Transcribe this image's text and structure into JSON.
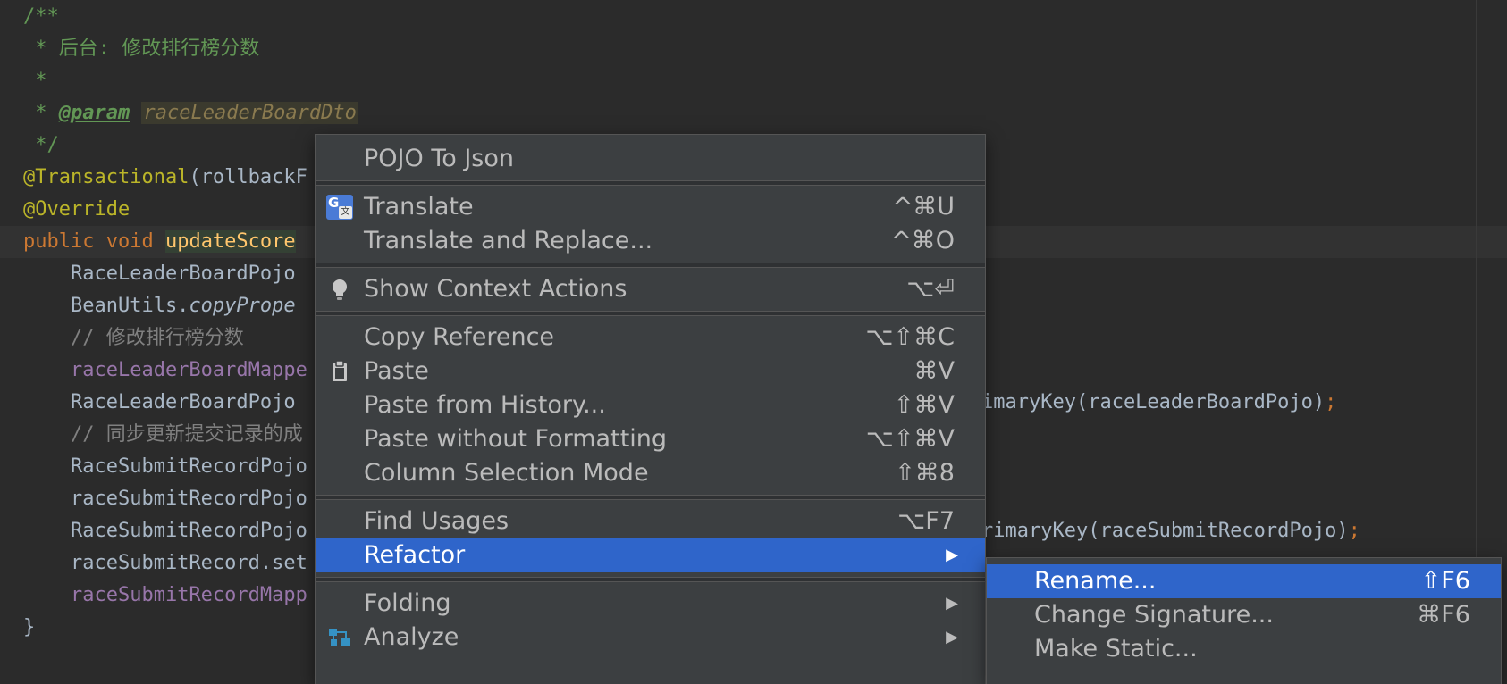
{
  "editor": {
    "lines": [
      [
        {
          "t": "/**",
          "c": "c-doc"
        }
      ],
      [
        {
          "t": " * 后台: 修改排行榜分数",
          "c": "c-doc"
        }
      ],
      [
        {
          "t": " *",
          "c": "c-doc"
        }
      ],
      [
        {
          "t": " * ",
          "c": "c-doc"
        },
        {
          "t": "@param",
          "c": "c-doctag"
        },
        {
          "t": " ",
          "c": "c-doc"
        },
        {
          "t": "raceLeaderBoardDto",
          "c": "c-docparam"
        }
      ],
      [
        {
          "t": " */",
          "c": "c-doc"
        }
      ],
      [
        {
          "t": "@Transactional",
          "c": "c-ann"
        },
        {
          "t": "(rollbackF",
          "c": ""
        }
      ],
      [
        {
          "t": "@Override",
          "c": "c-ann"
        }
      ],
      [
        {
          "t": "public ",
          "c": "c-kw"
        },
        {
          "t": "void ",
          "c": "c-kw"
        },
        {
          "t": "updateScore",
          "c": "c-fn"
        }
      ],
      [
        {
          "t": "    RaceLeaderBoardPojo",
          "c": ""
        }
      ],
      [
        {
          "t": "    BeanUtils.",
          "c": ""
        },
        {
          "t": "copyPrope",
          "c": "c-italic"
        }
      ],
      [
        {
          "t": "    // 修改排行榜分数",
          "c": "c-comment"
        }
      ],
      [
        {
          "t": "    ",
          "c": ""
        },
        {
          "t": "raceLeaderBoardMappe",
          "c": "c-field"
        }
      ],
      [
        {
          "t": "    RaceLeaderBoardPojo",
          "c": ""
        }
      ],
      [
        {
          "t": "    // 同步更新提交记录的成",
          "c": "c-comment"
        }
      ],
      [
        {
          "t": "    RaceSubmitRecordPojo",
          "c": ""
        }
      ],
      [
        {
          "t": "    raceSubmitRecordPojo",
          "c": ""
        }
      ],
      [
        {
          "t": "    RaceSubmitRecordPojo",
          "c": ""
        }
      ],
      [
        {
          "t": "    raceSubmitRecord.set",
          "c": ""
        }
      ],
      [
        {
          "t": "    ",
          "c": ""
        },
        {
          "t": "raceSubmitRecordMapp",
          "c": "c-field"
        }
      ],
      [
        {
          "t": "}",
          "c": ""
        }
      ]
    ],
    "tail_line_12": [
      {
        "t": "imaryKey(raceLeaderBoardPojo)",
        "c": ""
      },
      {
        "t": ";",
        "c": "c-punct"
      }
    ],
    "tail_line_16": [
      {
        "t": "rimaryKey(raceSubmitRecordPojo)",
        "c": ""
      },
      {
        "t": ";",
        "c": "c-punct"
      }
    ]
  },
  "menu": {
    "pojo_to_json": "POJO To Json",
    "translate": "Translate",
    "translate_sc": "^⌘U",
    "translate_replace": "Translate and Replace...",
    "translate_replace_sc": "^⌘O",
    "show_context_actions": "Show Context Actions",
    "show_context_actions_sc": "⌥⏎",
    "copy_reference": "Copy Reference",
    "copy_reference_sc": "⌥⇧⌘C",
    "paste": "Paste",
    "paste_sc": "⌘V",
    "paste_history": "Paste from History...",
    "paste_history_sc": "⇧⌘V",
    "paste_without_formatting": "Paste without Formatting",
    "paste_without_formatting_sc": "⌥⇧⌘V",
    "column_selection_mode": "Column Selection Mode",
    "column_selection_mode_sc": "⇧⌘8",
    "find_usages": "Find Usages",
    "find_usages_sc": "⌥F7",
    "refactor": "Refactor",
    "folding": "Folding",
    "analyze": "Analyze",
    "submenu_arrow": "▶"
  },
  "submenu": {
    "rename": "Rename...",
    "rename_sc": "⇧F6",
    "change_signature": "Change Signature...",
    "change_signature_sc": "⌘F6",
    "make_static": "Make Static..."
  },
  "icons": {
    "translate_icon": {
      "g": "G",
      "x": "文"
    }
  },
  "colors": {
    "selection": "#2f65ca",
    "menu_bg": "#3c3f41",
    "editor_bg": "#2b2b2b"
  }
}
